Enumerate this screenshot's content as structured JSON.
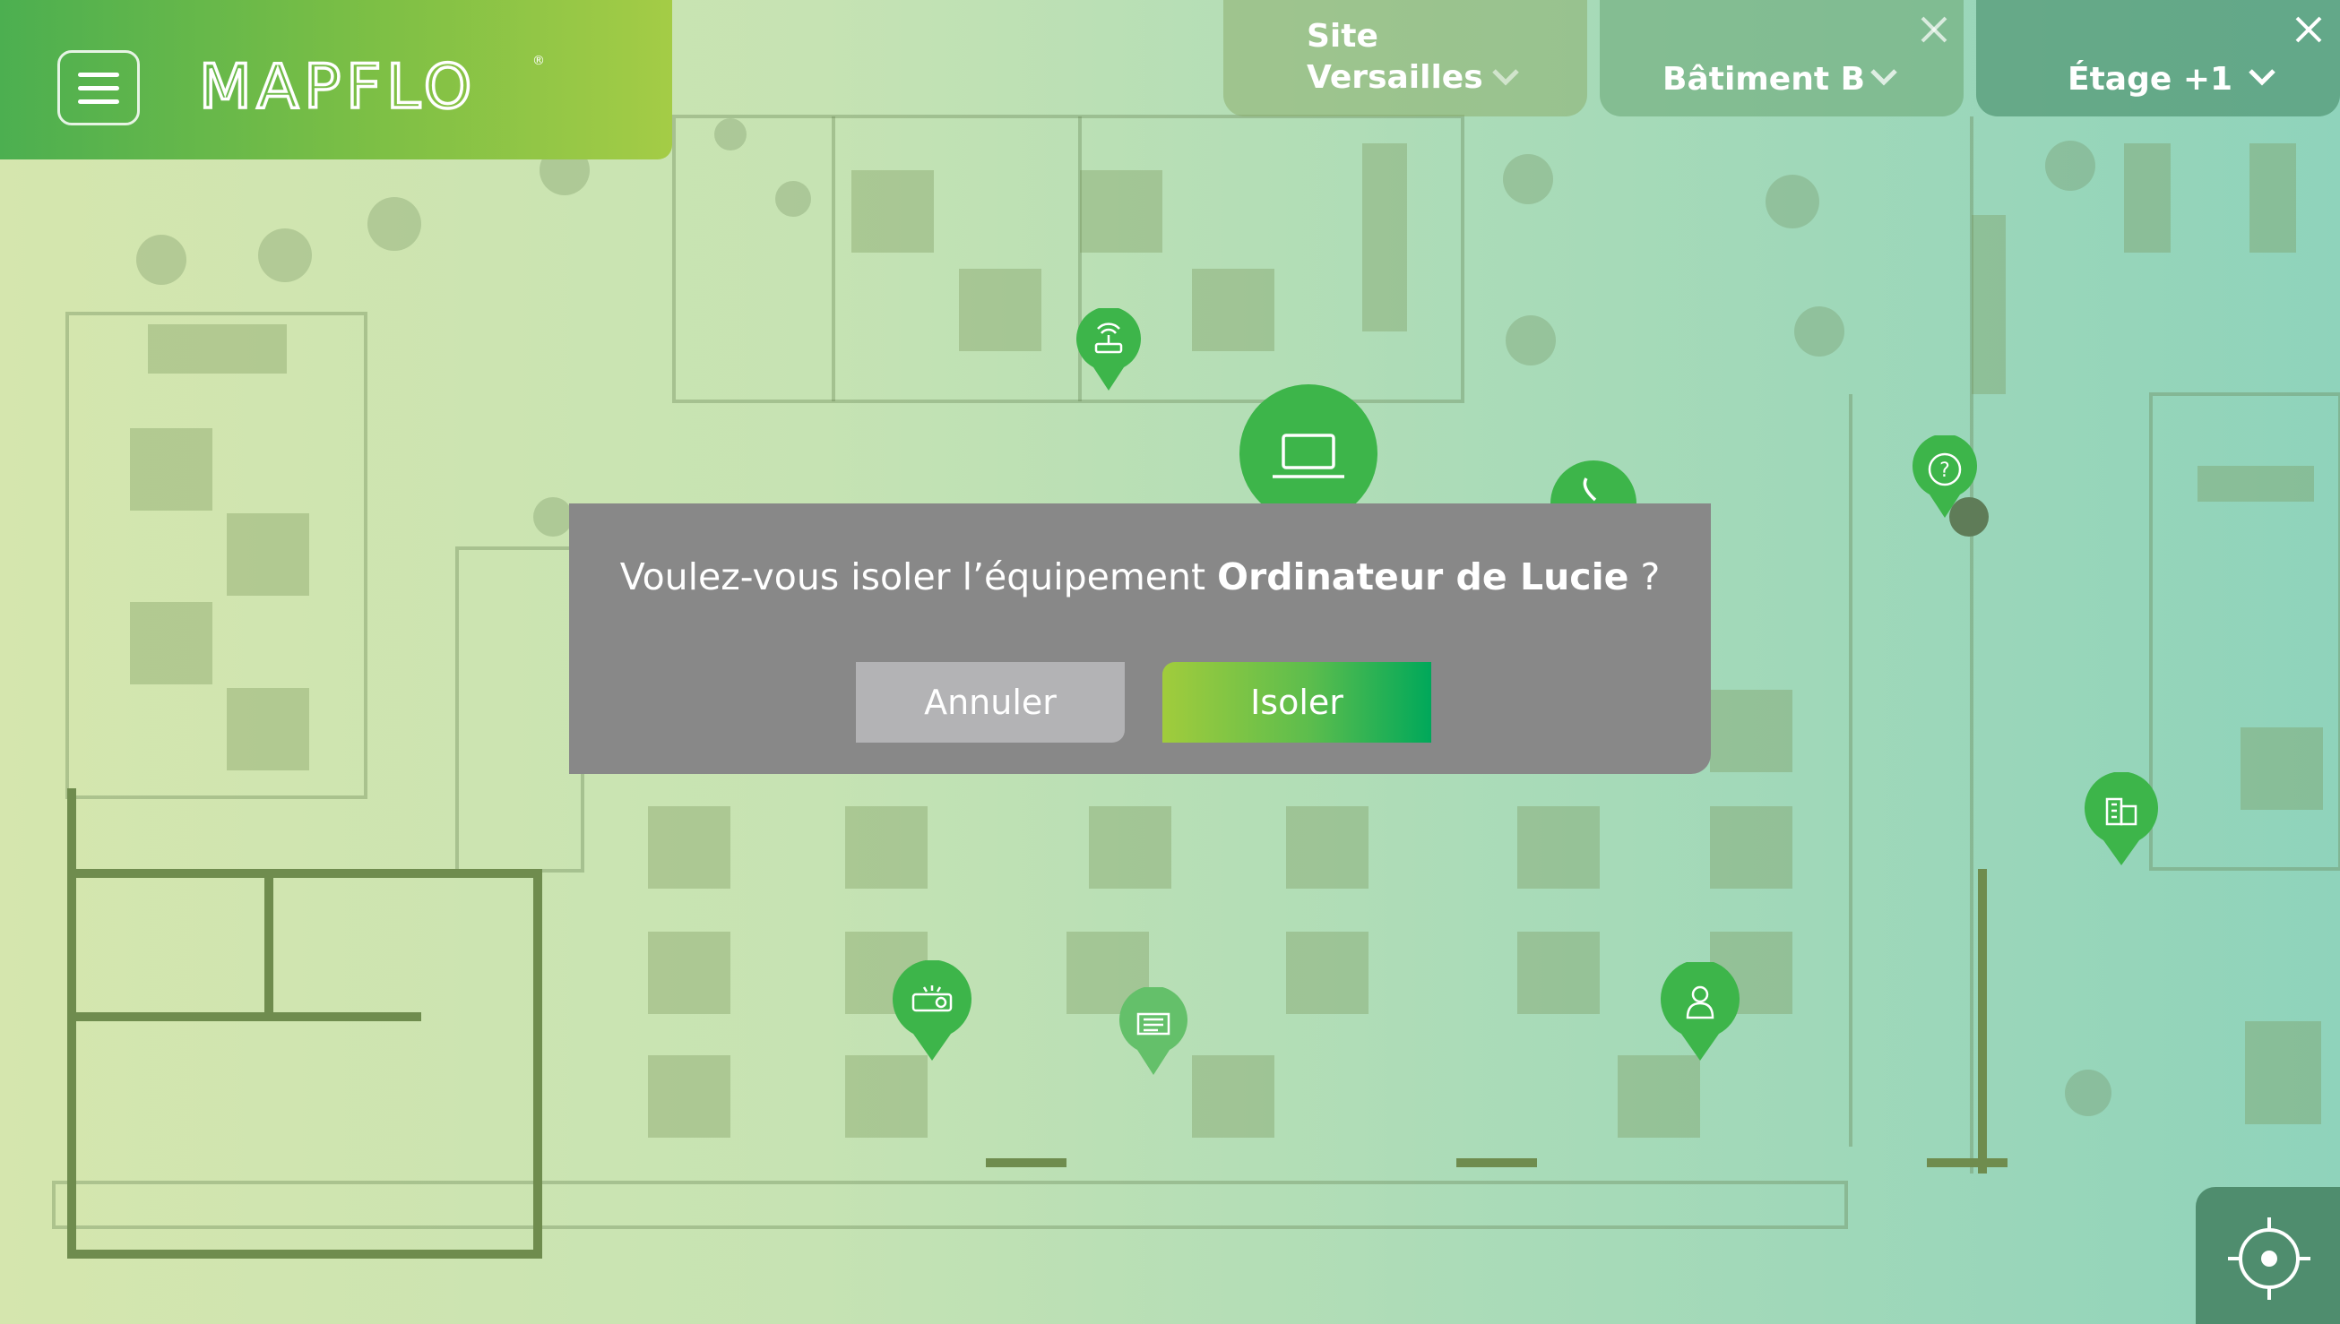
{
  "app": {
    "brand_name": "MAPFLO"
  },
  "colors": {
    "brand_green": "#7cbf45",
    "pin_green": "#3db54a",
    "dialog_gray": "#888888",
    "cancel_gray": "#b3b3b5"
  },
  "header": {
    "menu_icon": "hamburger-menu-icon",
    "site": {
      "line1": "Site",
      "line2": "Versailles"
    },
    "batiment": {
      "label": "Bâtiment B"
    },
    "etage": {
      "label": "Étage +1"
    }
  },
  "map_pins": [
    {
      "icon": "wifi-router-icon"
    },
    {
      "icon": "laptop-icon"
    },
    {
      "icon": "phone-icon"
    },
    {
      "icon": "help-question-icon"
    },
    {
      "icon": "building-icon"
    },
    {
      "icon": "projector-icon"
    },
    {
      "icon": "printer-icon"
    },
    {
      "icon": "person-icon"
    }
  ],
  "dialog": {
    "question_prefix": "Voulez-vous isoler l’équipement ",
    "equipment_name": "Ordinateur de Lucie",
    "question_suffix": " ?",
    "cancel_label": "Annuler",
    "confirm_label": "Isoler"
  },
  "locate_icon": "locate-crosshair-icon"
}
